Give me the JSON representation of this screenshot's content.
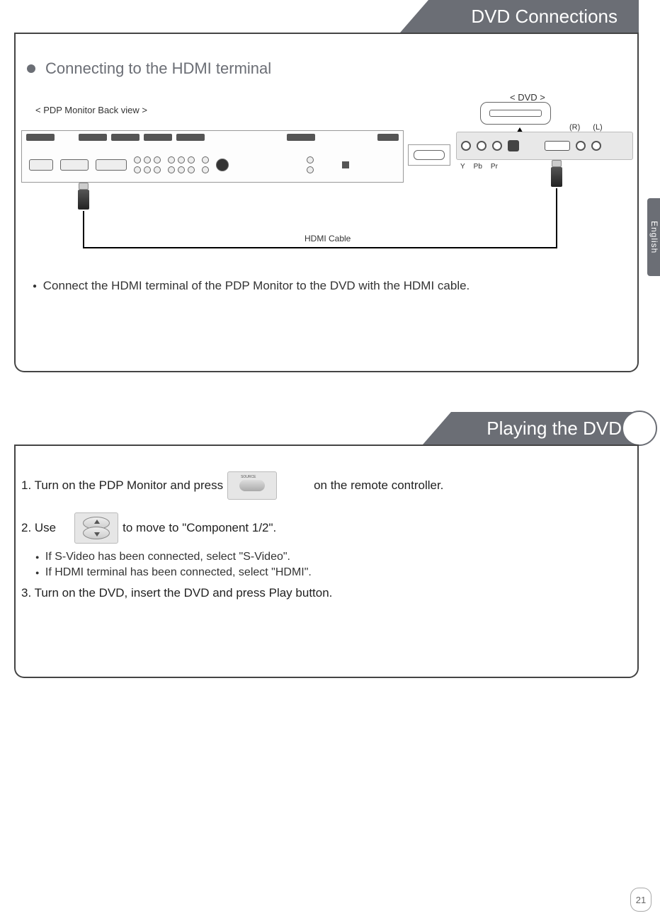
{
  "header1": "DVD Connections",
  "subheading1": "Connecting to the HDMI terminal",
  "labels": {
    "backview": "< PDP Monitor Back view >",
    "dvd": "< DVD >",
    "hdmiCable": "HDMI Cable",
    "R": "(R)",
    "L": "(L)",
    "Y": "Y",
    "Pb": "Pb",
    "Pr": "Pr"
  },
  "instruction1": "Connect the HDMI terminal of the PDP Monitor to the DVD with the HDMI cable.",
  "header2": "Playing the DVD",
  "steps": {
    "s1a": "1. Turn on the PDP Monitor and press",
    "s1b": "on the remote controller.",
    "s2a": "2. Use",
    "s2b": "to move to \"Component 1/2\".",
    "note1": "If S-Video has been connected, select \"S-Video\".",
    "note2": "If HDMI terminal has been connected, select \"HDMI\".",
    "s3": "3. Turn on the DVD, insert the DVD and press Play button."
  },
  "sideTab": "English",
  "pageNumber": "21"
}
